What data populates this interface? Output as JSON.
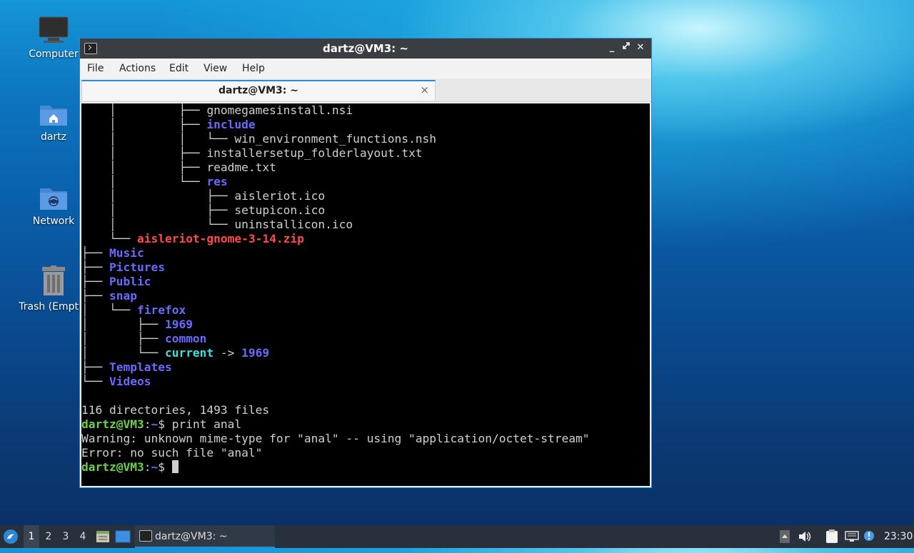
{
  "desktop": {
    "icons": [
      {
        "label": "Computer",
        "icon": "monitor-icon"
      },
      {
        "label": "dartz",
        "icon": "home-folder-icon"
      },
      {
        "label": "Network",
        "icon": "network-folder-icon"
      },
      {
        "label": "Trash (Empty)",
        "icon": "trash-icon"
      }
    ]
  },
  "window": {
    "title": "dartz@VM3: ~",
    "menu": [
      "File",
      "Actions",
      "Edit",
      "View",
      "Help"
    ],
    "tab_title": "dartz@VM3: ~",
    "tab_close": "×"
  },
  "terminal": {
    "lines": [
      [
        {
          "t": "    │         ├── "
        },
        {
          "t": "gnomegamesinstall.nsi"
        }
      ],
      [
        {
          "t": "    │         ├── "
        },
        {
          "t": "include",
          "c": "dir"
        }
      ],
      [
        {
          "t": "    │         │   └── "
        },
        {
          "t": "win_environment_functions.nsh"
        }
      ],
      [
        {
          "t": "    │         ├── "
        },
        {
          "t": "installersetup_folderlayout.txt"
        }
      ],
      [
        {
          "t": "    │         ├── "
        },
        {
          "t": "readme.txt"
        }
      ],
      [
        {
          "t": "    │         └── "
        },
        {
          "t": "res",
          "c": "dir"
        }
      ],
      [
        {
          "t": "    │             ├── "
        },
        {
          "t": "aisleriot.ico"
        }
      ],
      [
        {
          "t": "    │             ├── "
        },
        {
          "t": "setupicon.ico"
        }
      ],
      [
        {
          "t": "    │             └── "
        },
        {
          "t": "uninstallicon.ico"
        }
      ],
      [
        {
          "t": "    └── "
        },
        {
          "t": "aisleriot-gnome-3-14.zip",
          "c": "zip"
        }
      ],
      [
        {
          "t": "├── "
        },
        {
          "t": "Music",
          "c": "dir"
        }
      ],
      [
        {
          "t": "├── "
        },
        {
          "t": "Pictures",
          "c": "dir"
        }
      ],
      [
        {
          "t": "├── "
        },
        {
          "t": "Public",
          "c": "dir"
        }
      ],
      [
        {
          "t": "├── "
        },
        {
          "t": "snap",
          "c": "dir"
        }
      ],
      [
        {
          "t": "│   └── "
        },
        {
          "t": "firefox",
          "c": "dir"
        }
      ],
      [
        {
          "t": "│       ├── "
        },
        {
          "t": "1969",
          "c": "dir"
        }
      ],
      [
        {
          "t": "│       ├── "
        },
        {
          "t": "common",
          "c": "dir"
        }
      ],
      [
        {
          "t": "│       └── "
        },
        {
          "t": "current",
          "c": "lnk"
        },
        {
          "t": " -> "
        },
        {
          "t": "1969",
          "c": "dir"
        }
      ],
      [
        {
          "t": "├── "
        },
        {
          "t": "Templates",
          "c": "dir"
        }
      ],
      [
        {
          "t": "└── "
        },
        {
          "t": "Videos",
          "c": "dir"
        }
      ],
      [
        {
          "t": ""
        }
      ],
      [
        {
          "t": "116 directories, 1493 files"
        }
      ],
      [
        {
          "t": "dartz@VM3",
          "c": "pu"
        },
        {
          "t": ":"
        },
        {
          "t": "~",
          "c": "pp"
        },
        {
          "t": "$ print anal"
        }
      ],
      [
        {
          "t": "Warning: unknown mime-type for \"anal\" -- using \"application/octet-stream\""
        }
      ],
      [
        {
          "t": "Error: no such file \"anal\""
        }
      ],
      [
        {
          "t": "dartz@VM3",
          "c": "pu"
        },
        {
          "t": ":"
        },
        {
          "t": "~",
          "c": "pp"
        },
        {
          "t": "$ "
        },
        {
          "cursor": true
        }
      ]
    ]
  },
  "taskbar": {
    "start_icon": "lubuntu-logo-icon",
    "workspaces": [
      "1",
      "2",
      "3",
      "4"
    ],
    "active_workspace": "1",
    "task_label": "dartz@VM3: ~",
    "clock": "23:30"
  }
}
